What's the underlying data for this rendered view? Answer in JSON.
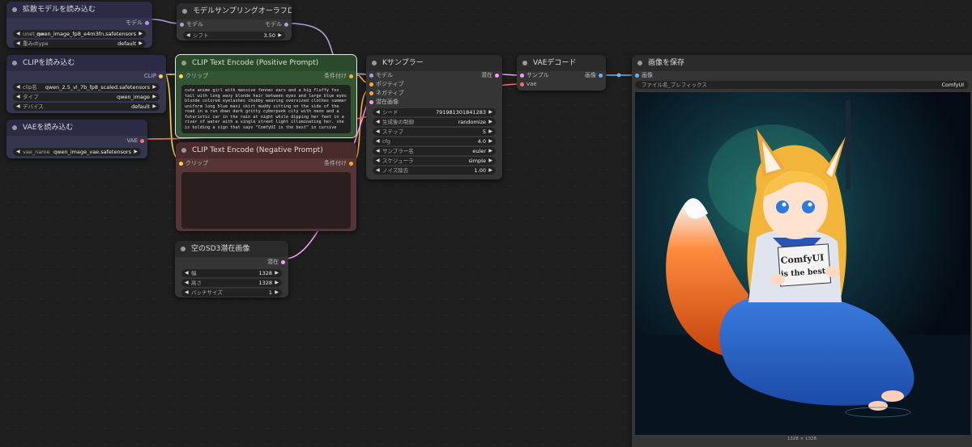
{
  "colors": {
    "model": "#b39ddb",
    "clip": "#ffd54f",
    "vae": "#ff6e6e",
    "conditioning": "#ffa931",
    "latent": "#ff9cf9",
    "image": "#64b5f6"
  },
  "diffusion_loader": {
    "title": "拡散モデルを読み込む",
    "out_model": "モデル",
    "unet_label": "unet_na...",
    "unet_value": "qwen_image_fp8_e4m3fn.safetensors",
    "dtype_label": "重みdtype",
    "dtype_value": "default"
  },
  "clip_loader": {
    "title": "CLIPを読み込む",
    "out_clip": "CLIP",
    "clip_label": "clip名",
    "clip_value": "qwen_2.5_vl_7b_fp8_scaled.safetensors",
    "type_label": "タイプ",
    "type_value": "qwen_image",
    "device_label": "デバイス",
    "device_value": "default"
  },
  "vae_loader": {
    "title": "VAEを読み込む",
    "out_vae": "VAE",
    "vae_label": "vae_name",
    "vae_value": "qwen_image_vae.safetensors"
  },
  "sampling_aura": {
    "title": "モデルサンプリングオーラフロー",
    "in_model": "モデル",
    "out_model": "モデル",
    "shift_label": "シフト",
    "shift_value": "3.50"
  },
  "pos_prompt": {
    "title": "CLIP Text Encode (Positive Prompt)",
    "in_clip": "クリップ",
    "out_cond": "条件付け",
    "text": "cute anime girl with massive fennec ears and a big fluffy fox tail with long wavy blonde hair between eyes and large blue eyes blonde colored eyelashes chubby wearing oversized clothes summer uniform long blue maxi skirt muddy sitting on the side of the road in a run down dark gritty cyberpunk city with neon and a futuristic car in the rain at night while dipping her feet in a river of water with a single street light illuminating her. she is holding a sign that says \"ComfyUI is the best\" in cursive"
  },
  "neg_prompt": {
    "title": "CLIP Text Encode (Negative Prompt)",
    "in_clip": "クリップ",
    "out_cond": "条件付け",
    "text": ""
  },
  "empty_latent": {
    "title": "空のSD3潜在画像",
    "out_latent": "潜在",
    "width_label": "幅",
    "width_value": "1328",
    "height_label": "高さ",
    "height_value": "1328",
    "batch_label": "バッチサイズ",
    "batch_value": "1"
  },
  "ksampler": {
    "title": "Kサンプラー",
    "in_model": "モデル",
    "in_pos": "ポジティブ",
    "in_neg": "ネガティブ",
    "in_latent": "潜在画像",
    "out_latent": "潜在",
    "seed_label": "シード",
    "seed_value": "791981301841283",
    "control_label": "生成後の制御",
    "control_value": "randomize",
    "steps_label": "ステップ",
    "steps_value": "5",
    "cfg_label": "cfg",
    "cfg_value": "4.0",
    "sampler_label": "サンプラー名",
    "sampler_value": "euler",
    "scheduler_label": "スケジューラ",
    "scheduler_value": "simple",
    "denoise_label": "ノイズ除去",
    "denoise_value": "1.00"
  },
  "vae_decode": {
    "title": "VAEデコード",
    "in_samples": "サンプル",
    "in_vae": "vae",
    "out_image": "画像"
  },
  "save_image": {
    "title": "画像を保存",
    "in_images": "画像",
    "prefix_label": "ファイル名_プレフィックス",
    "prefix_value": "ComfyUI",
    "image_size": "1328 × 1328",
    "sign_line1": "ComfyUI",
    "sign_line2": "is the best"
  }
}
